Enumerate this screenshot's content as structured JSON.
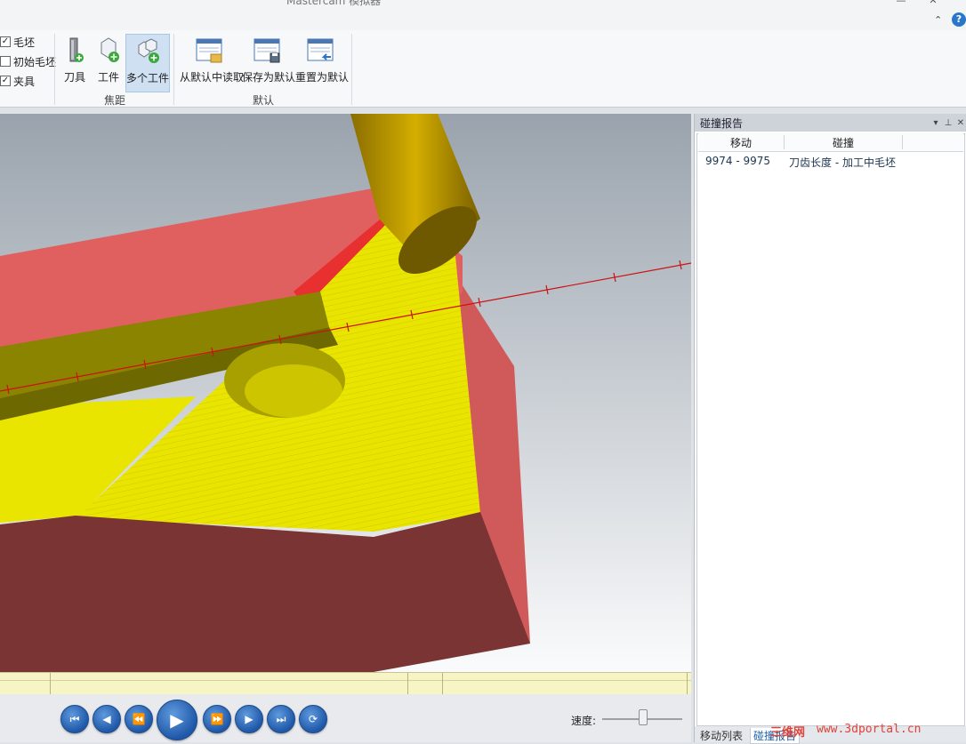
{
  "window": {
    "title": "Mastercam 模拟器"
  },
  "ribbon": {
    "checkboxes": [
      {
        "label": "毛坯",
        "checked": true
      },
      {
        "label": "初始毛坯",
        "checked": false
      },
      {
        "label": "夹具",
        "checked": true
      }
    ],
    "focus_group": {
      "label": "焦距",
      "buttons": [
        {
          "label": "刀具",
          "icon": "tool-plus-icon"
        },
        {
          "label": "工件",
          "icon": "workpiece-plus-icon"
        },
        {
          "label": "多个工件",
          "icon": "multi-workpiece-plus-icon",
          "active": true
        }
      ]
    },
    "default_group": {
      "label": "默认",
      "buttons": [
        {
          "label": "从默认中读取",
          "icon": "read-default-icon"
        },
        {
          "label": "保存为默认",
          "icon": "save-default-icon"
        },
        {
          "label": "重置为默认",
          "icon": "reset-default-icon"
        }
      ]
    }
  },
  "collision_panel": {
    "title": "碰撞报告",
    "columns": [
      "移动",
      "碰撞"
    ],
    "rows": [
      {
        "move": "9974 - 9975",
        "collision": "刀齿长度 - 加工中毛坯"
      }
    ],
    "tabs": [
      {
        "label": "移动列表",
        "active": false
      },
      {
        "label": "碰撞报告",
        "active": true
      }
    ]
  },
  "playback": {
    "speed_label": "速度:",
    "speed_fraction": 0.5,
    "buttons": [
      "first-icon",
      "step-back-icon",
      "rewind-icon",
      "play-icon",
      "fast-forward-icon",
      "step-forward-icon",
      "last-icon",
      "loop-icon"
    ]
  },
  "watermark": {
    "cn": "三维网",
    "url": "www.3dportal.cn"
  },
  "colors": {
    "stock_top": "#e0605f",
    "stock_front": "#7a3434",
    "stock_side": "#d05a5a",
    "machined": "#e9e400",
    "tool": "#c9a400",
    "toolpath": "#cc1111",
    "accent": "#2a77c9"
  }
}
